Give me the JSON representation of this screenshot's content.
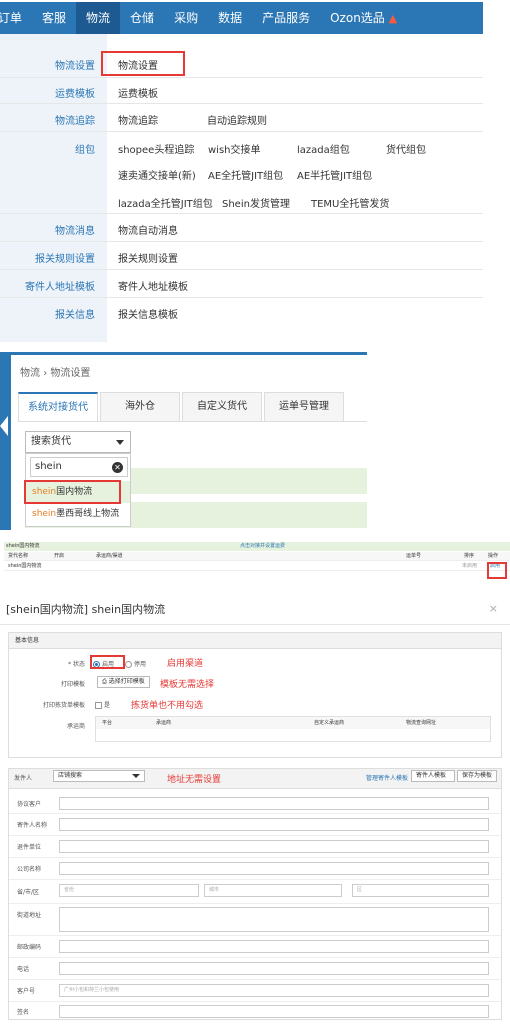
{
  "nav": {
    "items": [
      "订单",
      "客服",
      "物流",
      "仓储",
      "采购",
      "数据",
      "产品服务",
      "Ozon选品"
    ],
    "active": "物流",
    "hot_icon": "flame-icon"
  },
  "menu": {
    "logistics_settings": {
      "label": "物流设置",
      "links": [
        "物流设置"
      ]
    },
    "freight_template": {
      "label": "运费模板",
      "links": [
        "运费模板"
      ]
    },
    "tracking": {
      "label": "物流追踪",
      "links": [
        "物流追踪",
        "自动追踪规则"
      ]
    },
    "package": {
      "label": "组包",
      "links": [
        "shopee头程追踪",
        "wish交接单",
        "lazada组包",
        "货代组包",
        "速卖通交接单(新)",
        "AE全托管JIT组包",
        "AE半托管JIT组包",
        "lazada全托管JIT组包",
        "Shein发货管理",
        "TEMU全托管发货"
      ]
    },
    "message": {
      "label": "物流消息",
      "links": [
        "物流自动消息"
      ]
    },
    "customs_rules": {
      "label": "报关规则设置",
      "links": [
        "报关规则设置"
      ]
    },
    "sender_address": {
      "label": "寄件人地址模板",
      "links": [
        "寄件人地址模板"
      ]
    },
    "customs_info": {
      "label": "报关信息",
      "links": [
        "报关信息模板"
      ]
    }
  },
  "panel2": {
    "breadcrumb": [
      "物流",
      "物流设置"
    ],
    "tabs": [
      "系统对接货代",
      "海外仓",
      "自定义货代",
      "运单号管理"
    ],
    "active_tab": "系统对接货代",
    "select_value": "搜索货代",
    "search_value": "shein",
    "options": [
      {
        "match": "shein",
        "rest": "国内物流"
      },
      {
        "match": "shein",
        "rest": "墨西哥线上物流"
      }
    ]
  },
  "panel3": {
    "header_left": "shein国内物流",
    "header_center": "点击对接并设置运费",
    "columns": [
      "货代名称",
      "开启",
      "承运商/渠道",
      "运单号",
      "",
      "排序",
      "操作"
    ],
    "row": {
      "name": "shein国内物流",
      "status": "未启用",
      "action": "启用"
    }
  },
  "modal": {
    "title": "[shein国内物流] shein国内物流",
    "close": "×",
    "basic_section": "基本信息",
    "status_label": "* 状态",
    "status_on": "启用",
    "status_off": "停用",
    "print_label": "打印模板",
    "print_button": "选择打印模板",
    "pick_label": "打印拣货单模板",
    "pick_checkbox": "是",
    "carrier_label": "承运商",
    "carrier_columns": [
      "平台",
      "承运商",
      "自定义承运商",
      "物流查询网址"
    ],
    "notes": [
      "启用渠道",
      "模板无需选择",
      "拣货单也不用勾选",
      "地址无需设置"
    ],
    "sender_label": "发件人",
    "sender_select": "店铺搜索",
    "sender_manage": "管理寄件人模板",
    "sender_template_select": "寄件人模板",
    "save_template": "保存为模板",
    "fields": [
      "协议客户",
      "寄件人名称",
      "退件单位",
      "公司名称",
      "省/市/区",
      "街道地址",
      "邮政编码",
      "电话",
      "客户号",
      "签名"
    ],
    "province_placeholder": "省份",
    "city_placeholder": "城市",
    "district_placeholder": "区",
    "customer_no_placeholder": "广州小包和荷兰小包使用"
  }
}
